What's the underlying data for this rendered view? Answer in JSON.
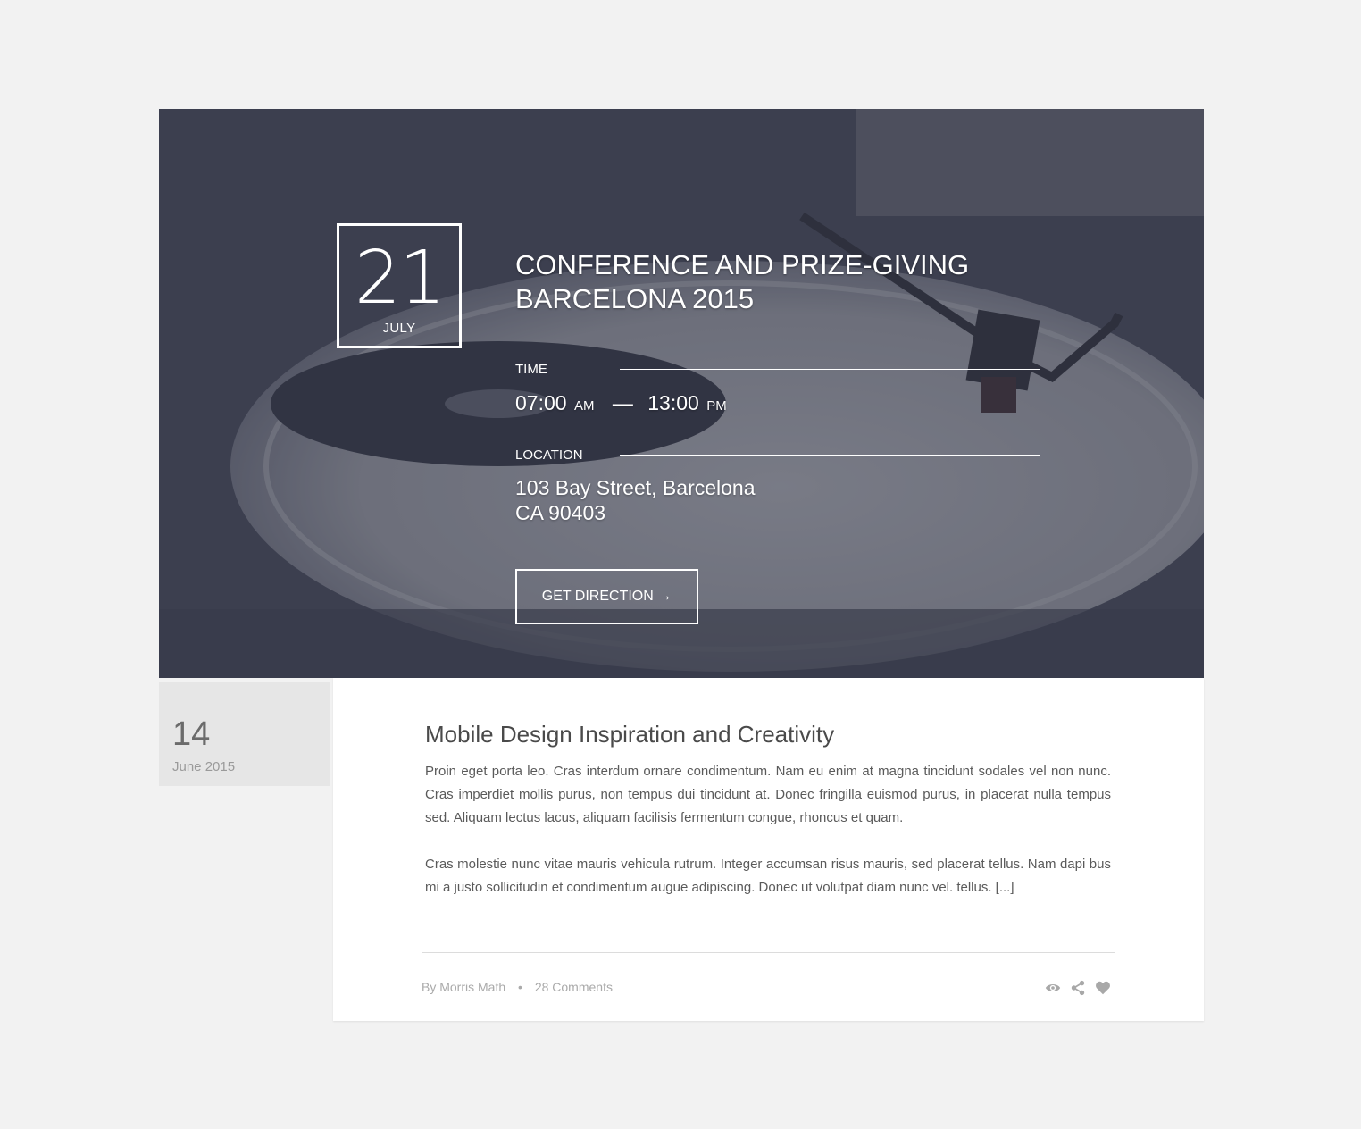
{
  "event": {
    "day": "21",
    "month": "JULY",
    "title_line1": "CONFERENCE AND PRIZE-GIVING",
    "title_line2": "BARCELONA 2015",
    "time_label": "TIME",
    "time_start": "07:00",
    "time_start_suffix": "AM",
    "time_separator": "—",
    "time_end": "13:00",
    "time_end_suffix": "PM",
    "location_label": "LOCATION",
    "location_line1": "103 Bay Street, Barcelona",
    "location_line2": "CA 90403",
    "button_label": "GET DIRECTION →"
  },
  "post": {
    "day": "14",
    "month_year": "June 2015",
    "title": "Mobile Design Inspiration and Creativity",
    "paragraph1": "Proin eget porta leo. Cras interdum ornare condimentum. Nam eu enim at magna tincidunt sodales vel non nunc. Cras imperdiet mollis purus, non tempus dui tincidunt at. Donec fringilla euismod purus, in placerat nulla tempus sed. Aliquam lectus lacus, aliquam facilisis fermentum congue, rhoncus et quam.",
    "paragraph2": "Cras molestie nunc vitae mauris vehicula rutrum. Integer accumsan risus mauris, sed placerat tellus. Nam dapi bus mi a justo sollicitudin et condimentum augue adipiscing. Donec ut volutpat diam nunc vel. tellus. [...]",
    "author": "By Morris Math",
    "meta_separator": "•",
    "comments": "28 Comments",
    "icons": [
      "eye-icon",
      "share-icon",
      "heart-icon"
    ]
  },
  "colors": {
    "page_bg": "#f2f2f2",
    "hero_overlay": "#373a4a",
    "card_bg": "#ffffff",
    "date_bg": "#e6e6e6",
    "meta_text": "#aaaaaa"
  }
}
